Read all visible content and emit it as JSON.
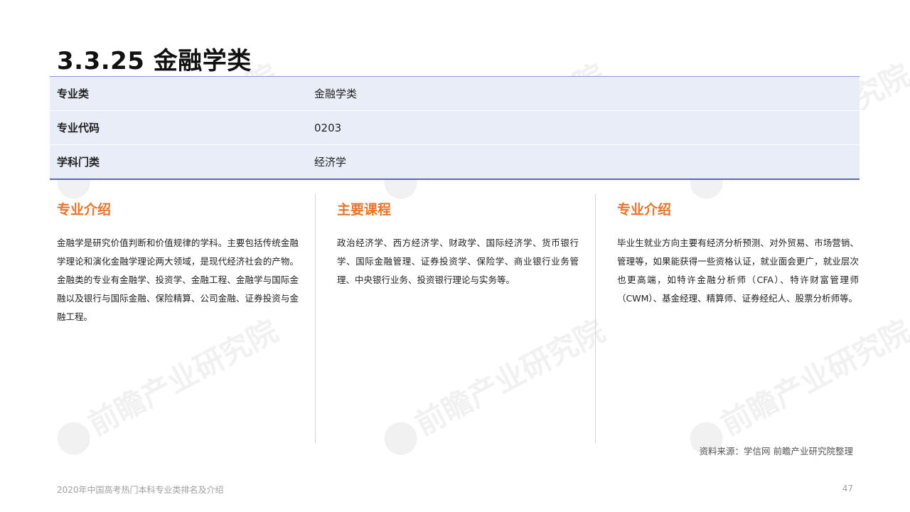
{
  "title": "3.3.25 金融学类",
  "info_table": [
    {
      "key": "专业类",
      "value": "金融学类"
    },
    {
      "key": "专业代码",
      "value": "0203"
    },
    {
      "key": "学科门类",
      "value": "经济学"
    }
  ],
  "columns": [
    {
      "heading": "专业介绍",
      "text": "金融学是研究价值判断和价值规律的学科。主要包括传统金融学理论和演化金融学理论两大领域，是现代经济社会的产物。金融类的专业有金融学、投资学、金融工程、金融学与国际金融以及银行与国际金融、保险精算、公司金融、证券投资与金融工程。"
    },
    {
      "heading": "主要课程",
      "text": "政治经济学、西方经济学、财政学、国际经济学、货币银行学、国际金融管理、证券投资学、保险学、商业银行业务管理、中央银行业务、投资银行理论与实务等。"
    },
    {
      "heading": "专业介绍",
      "text": "毕业生就业方向主要有经济分析预测、对外贸易、市场营销、管理等，如果能获得一些资格认证，就业面会更广，就业层次也更高端，如特许金融分析师（CFA）、特许财富管理师（CWM）、基金经理、精算师、证券经纪人、股票分析师等。"
    }
  ],
  "source": "资料来源：学信网 前瞻产业研究院整理",
  "footer": {
    "left": "2020年中国高考热门本科专业类排名及介绍",
    "page": "47"
  },
  "watermark": "前瞻产业研究院",
  "colors": {
    "accent": "#e8742a",
    "table_bg": "#e8edf8",
    "table_border": "#5b6ba8"
  }
}
